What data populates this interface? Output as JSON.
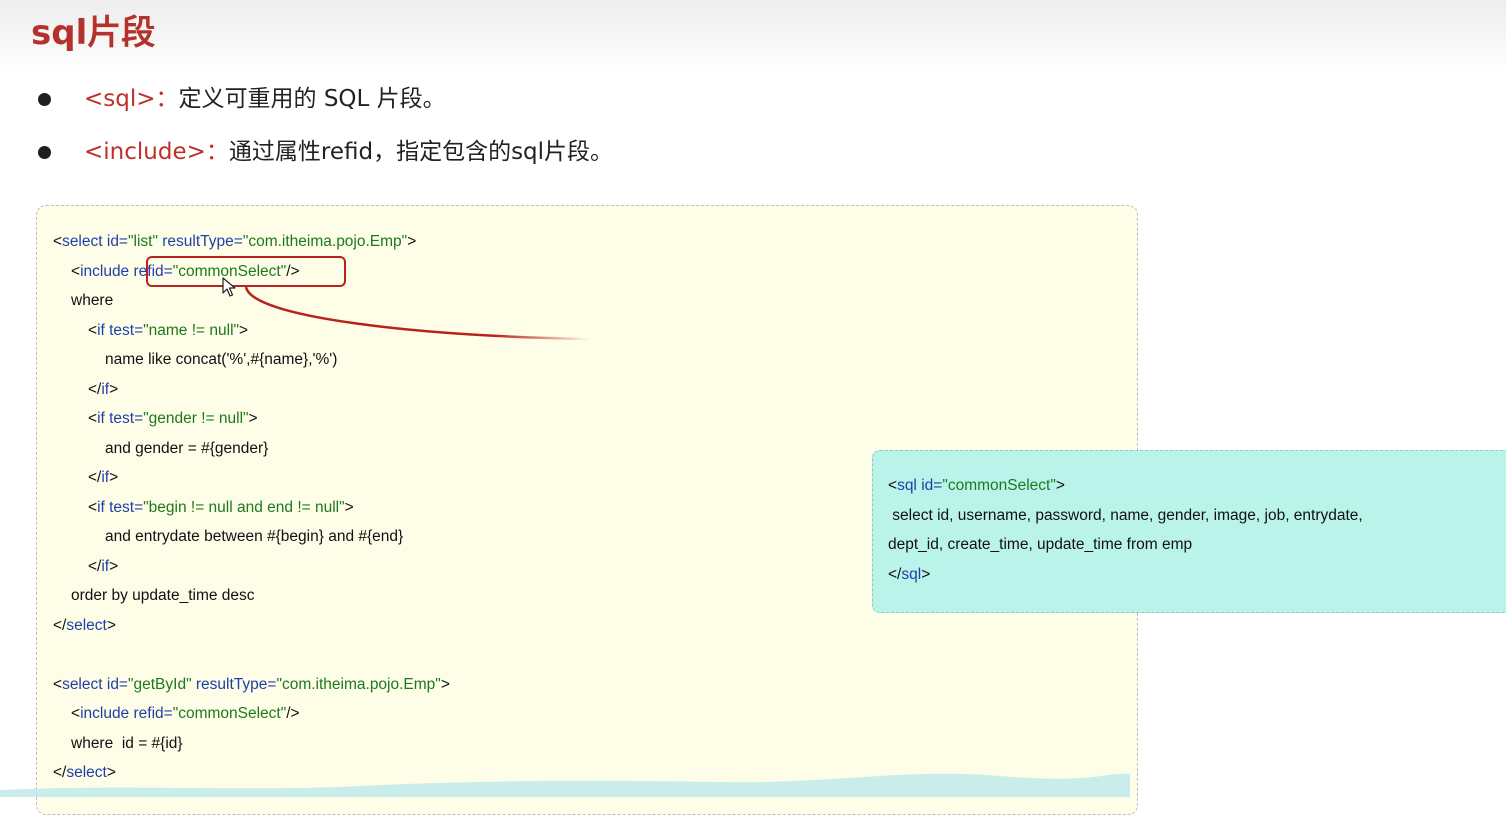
{
  "slide": {
    "title": "sql片段"
  },
  "bullets": [
    {
      "tag": "<sql>",
      "colon": "：",
      "text": "定义可重用的 SQL 片段。"
    },
    {
      "tag": "<include>",
      "colon": "：",
      "text": "通过属性refid，指定包含的sql片段。"
    }
  ],
  "code_list": {
    "l1": {
      "lt": "<",
      "tag": "select",
      "a1": " id=",
      "v1": "\"list\"",
      "a2": " resultType=",
      "v2": "\"com.itheima.pojo.Emp\"",
      "gt": ">"
    },
    "l2": {
      "lt": "<",
      "tag": "include",
      "a1": " refid=",
      "v1": "\"commonSelect\"",
      "gt": "/>"
    },
    "l3": "where",
    "l4": {
      "lt": "<",
      "tag": "if",
      "a1": " test=",
      "v1": "\"name != null\"",
      "gt": ">"
    },
    "l5": "name like concat('%',#{name},'%')",
    "l6": {
      "lt": "</",
      "tag": "if",
      "gt": ">"
    },
    "l7": {
      "lt": "<",
      "tag": "if",
      "a1": " test=",
      "v1": "\"gender != null\"",
      "gt": ">"
    },
    "l8": "and gender = #{gender}",
    "l9": {
      "lt": "</",
      "tag": "if",
      "gt": ">"
    },
    "l10": {
      "lt": "<",
      "tag": "if",
      "a1": " test=",
      "v1": "\"begin != null and end != null\"",
      "gt": ">"
    },
    "l11": "and entrydate between #{begin} and #{end}",
    "l12": {
      "lt": "</",
      "tag": "if",
      "gt": ">"
    },
    "l13": "order by update_time desc",
    "l14": {
      "lt": "</",
      "tag": "select",
      "gt": ">"
    }
  },
  "code_getbyid": {
    "l1": {
      "lt": "<",
      "tag": "select",
      "a1": " id=",
      "v1": "\"getById\"",
      "a2": " resultType=",
      "v2": "\"com.itheima.pojo.Emp\"",
      "gt": ">"
    },
    "l2": {
      "lt": "<",
      "tag": "include",
      "a1": " refid=",
      "v1": "\"commonSelect\"",
      "gt": "/>"
    },
    "l3": "where  id = #{id}",
    "l4": {
      "lt": "</",
      "tag": "select",
      "gt": ">"
    }
  },
  "sql_fragment": {
    "l1": {
      "lt": "<",
      "tag": "sql",
      "a1": " id=",
      "v1": "\"commonSelect\"",
      "gt": ">"
    },
    "l2": " select id, username, password, name, gender, image, job, entrydate,",
    "l3": "dept_id, create_time, update_time from emp",
    "l4": {
      "lt": "</",
      "tag": "sql",
      "gt": ">"
    }
  },
  "colors": {
    "title": "#b5322c",
    "tag": "#c0302a",
    "xml_keyword": "#1f3fa8",
    "xml_string": "#1c7a1c",
    "code_card_bg": "#fefde8",
    "sql_card_bg": "#b9f3e9",
    "highlight": "#b7231c"
  },
  "icons": [
    "cursor-arrow-icon",
    "connector-arrow-icon"
  ]
}
